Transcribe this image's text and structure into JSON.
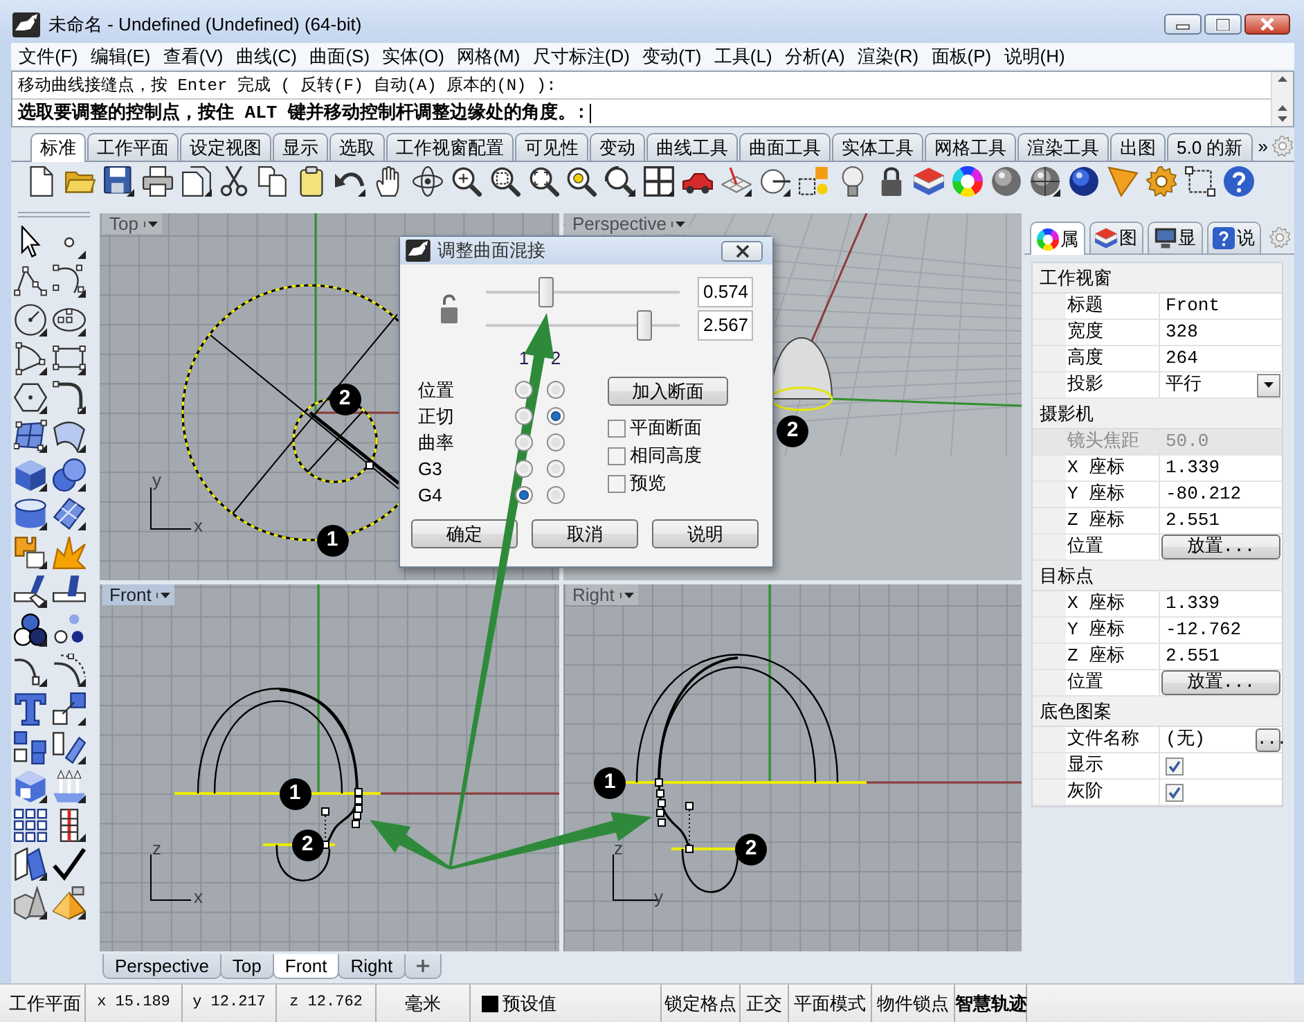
{
  "window": {
    "title": "未命名 - Undefined (Undefined) (64-bit)"
  },
  "menu": [
    "文件(F)",
    "编辑(E)",
    "查看(V)",
    "曲线(C)",
    "曲面(S)",
    "实体(O)",
    "网格(M)",
    "尺寸标注(D)",
    "变动(T)",
    "工具(L)",
    "分析(A)",
    "渲染(R)",
    "面板(P)",
    "说明(H)"
  ],
  "command": {
    "history": [
      "移动曲线接缝点，按 Enter 完成 ( 反转(F) 自动(A) 原本的(N) ):"
    ],
    "prompt": "选取要调整的控制点，按住 ALT 键并移动控制杆调整边缘处的角度。:"
  },
  "toolbar_tabs": {
    "tabs": [
      {
        "label": "标准",
        "selected": true
      },
      {
        "label": "工作平面",
        "selected": false
      },
      {
        "label": "设定视图",
        "selected": false
      },
      {
        "label": "显示",
        "selected": false
      },
      {
        "label": "选取",
        "selected": false
      },
      {
        "label": "工作视窗配置",
        "selected": false
      },
      {
        "label": "可见性",
        "selected": false
      },
      {
        "label": "变动",
        "selected": false
      },
      {
        "label": "曲线工具",
        "selected": false
      },
      {
        "label": "曲面工具",
        "selected": false
      },
      {
        "label": "实体工具",
        "selected": false
      },
      {
        "label": "网格工具",
        "selected": false
      },
      {
        "label": "渲染工具",
        "selected": false
      },
      {
        "label": "出图",
        "selected": false
      },
      {
        "label": "5.0 的新",
        "selected": false
      }
    ],
    "overflow": "»"
  },
  "viewports": [
    {
      "kind": "top",
      "title": "Top",
      "active": false,
      "markers": [
        "2",
        "1"
      ],
      "axes": [
        "y",
        "x"
      ]
    },
    {
      "kind": "perspective",
      "title": "Perspective",
      "active": false,
      "markers": [
        "2"
      ]
    },
    {
      "kind": "front",
      "title": "Front",
      "active": true,
      "markers": [
        "1",
        "2"
      ],
      "axes": [
        "z",
        "x"
      ]
    },
    {
      "kind": "right",
      "title": "Right",
      "active": false,
      "markers": [
        "1",
        "2"
      ],
      "axes": [
        "z",
        "y"
      ]
    }
  ],
  "viewport_tabs": [
    {
      "label": "Perspective",
      "selected": false
    },
    {
      "label": "Top",
      "selected": false
    },
    {
      "label": "Front",
      "selected": true
    },
    {
      "label": "Right",
      "selected": false
    }
  ],
  "dialog": {
    "title": "调整曲面混接",
    "locked": false,
    "sliders": [
      {
        "level": 0.31,
        "value": "0.574"
      },
      {
        "level": 0.82,
        "value": "2.567"
      }
    ],
    "columns": [
      "1",
      "2"
    ],
    "continuity": [
      {
        "label": "位置",
        "options": [
          {
            "selected": false
          },
          {
            "selected": false
          }
        ]
      },
      {
        "label": "正切",
        "options": [
          {
            "selected": false
          },
          {
            "selected": true
          }
        ]
      },
      {
        "label": "曲率",
        "options": [
          {
            "selected": false
          },
          {
            "selected": false
          }
        ]
      },
      {
        "label": "G3",
        "options": [
          {
            "selected": false
          },
          {
            "selected": false
          }
        ]
      },
      {
        "label": "G4",
        "options": [
          {
            "selected": true
          },
          {
            "selected": false
          }
        ]
      }
    ],
    "add_section": "加入断面",
    "options": [
      {
        "label": "平面断面",
        "checked": false
      },
      {
        "label": "相同高度",
        "checked": false
      },
      {
        "label": "预览",
        "checked": false
      }
    ],
    "buttons": [
      "确定",
      "取消",
      "说明"
    ]
  },
  "panel": {
    "tabs": [
      {
        "label": "属",
        "selected": true
      },
      {
        "label": "图",
        "selected": false
      },
      {
        "label": "显",
        "selected": false
      },
      {
        "label": "说",
        "selected": false
      }
    ],
    "sections": [
      {
        "title": "工作视窗",
        "rows": [
          {
            "label": "标题",
            "kind": "text",
            "value": "Front",
            "disabled": false
          },
          {
            "label": "宽度",
            "kind": "text",
            "value": "328",
            "disabled": false
          },
          {
            "label": "高度",
            "kind": "text",
            "value": "264",
            "disabled": false
          },
          {
            "label": "投影",
            "kind": "dropdown",
            "value": "平行",
            "disabled": false
          }
        ]
      },
      {
        "title": "摄影机",
        "rows": [
          {
            "label": "镜头焦距",
            "kind": "text",
            "value": "50.0",
            "disabled": true
          },
          {
            "label": "X 座标",
            "kind": "text",
            "value": "1.339",
            "disabled": false
          },
          {
            "label": "Y 座标",
            "kind": "text",
            "value": "-80.212",
            "disabled": false
          },
          {
            "label": "Z 座标",
            "kind": "text",
            "value": "2.551",
            "disabled": false
          },
          {
            "label": "位置",
            "kind": "button",
            "button": "放置...",
            "disabled": false
          }
        ]
      },
      {
        "title": "目标点",
        "rows": [
          {
            "label": "X 座标",
            "kind": "text",
            "value": "1.339",
            "disabled": false
          },
          {
            "label": "Y 座标",
            "kind": "text",
            "value": "-12.762",
            "disabled": false
          },
          {
            "label": "Z 座标",
            "kind": "text",
            "value": "2.551",
            "disabled": false
          },
          {
            "label": "位置",
            "kind": "button",
            "button": "放置...",
            "disabled": false
          }
        ]
      },
      {
        "title": "底色图案",
        "rows": [
          {
            "label": "文件名称",
            "kind": "file",
            "value": "(无)",
            "button": "...",
            "disabled": false
          },
          {
            "label": "显示",
            "kind": "checkbox",
            "checked": true,
            "disabled": false
          },
          {
            "label": "灰阶",
            "kind": "checkbox",
            "checked": true,
            "disabled": false
          }
        ]
      }
    ]
  },
  "status_bar": {
    "cells": [
      {
        "kind": "text",
        "text": "工作平面"
      },
      {
        "kind": "coord",
        "text": "x 15.189"
      },
      {
        "kind": "coord",
        "text": "y 12.217"
      },
      {
        "kind": "coord",
        "text": "z 12.762"
      },
      {
        "kind": "text",
        "text": "毫米"
      },
      {
        "kind": "layer",
        "text": "预设值"
      }
    ],
    "toggles": [
      {
        "label": "锁定格点",
        "on": false
      },
      {
        "label": "正交",
        "on": false
      },
      {
        "label": "平面模式",
        "on": false
      },
      {
        "label": "物件锁点",
        "on": false
      },
      {
        "label": "智慧轨迹",
        "on": true
      }
    ]
  }
}
